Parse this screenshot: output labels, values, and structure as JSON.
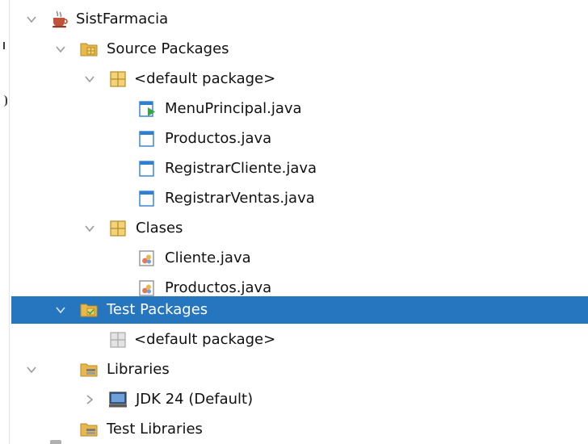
{
  "project_tree": {
    "project": {
      "label": "SistFarmacia",
      "icon": "coffee-cup-project-icon"
    },
    "source_packages": {
      "label": "Source Packages",
      "icon": "source-folder-icon",
      "default_package": {
        "label": "<default package>",
        "icon": "package-icon",
        "files": [
          {
            "label": "MenuPrincipal.java",
            "icon": "runnable-form-file-icon"
          },
          {
            "label": "Productos.java",
            "icon": "form-file-icon"
          },
          {
            "label": "RegistrarCliente.java",
            "icon": "form-file-icon"
          },
          {
            "label": "RegistrarVentas.java",
            "icon": "form-file-icon"
          }
        ]
      },
      "clases_package": {
        "label": "Clases",
        "icon": "package-icon",
        "files": [
          {
            "label": "Cliente.java",
            "icon": "java-class-file-icon"
          },
          {
            "label": "Productos.java",
            "icon": "java-class-file-icon"
          }
        ]
      }
    },
    "test_packages": {
      "label": "Test Packages",
      "icon": "test-folder-icon",
      "selected": true,
      "default_package": {
        "label": "<default package>",
        "icon": "empty-package-icon"
      }
    },
    "libraries": {
      "label": "Libraries",
      "icon": "library-folder-icon",
      "jdk": {
        "label": "JDK 24 (Default)",
        "icon": "jdk-platform-icon"
      }
    },
    "test_libraries": {
      "label": "Test Libraries",
      "icon": "library-folder-icon"
    }
  },
  "colors": {
    "selection": "#2675bf",
    "folder": "#e8b84a",
    "package": "#e0b24a",
    "file_blue": "#2f7fd0",
    "run_green": "#3aa545"
  }
}
